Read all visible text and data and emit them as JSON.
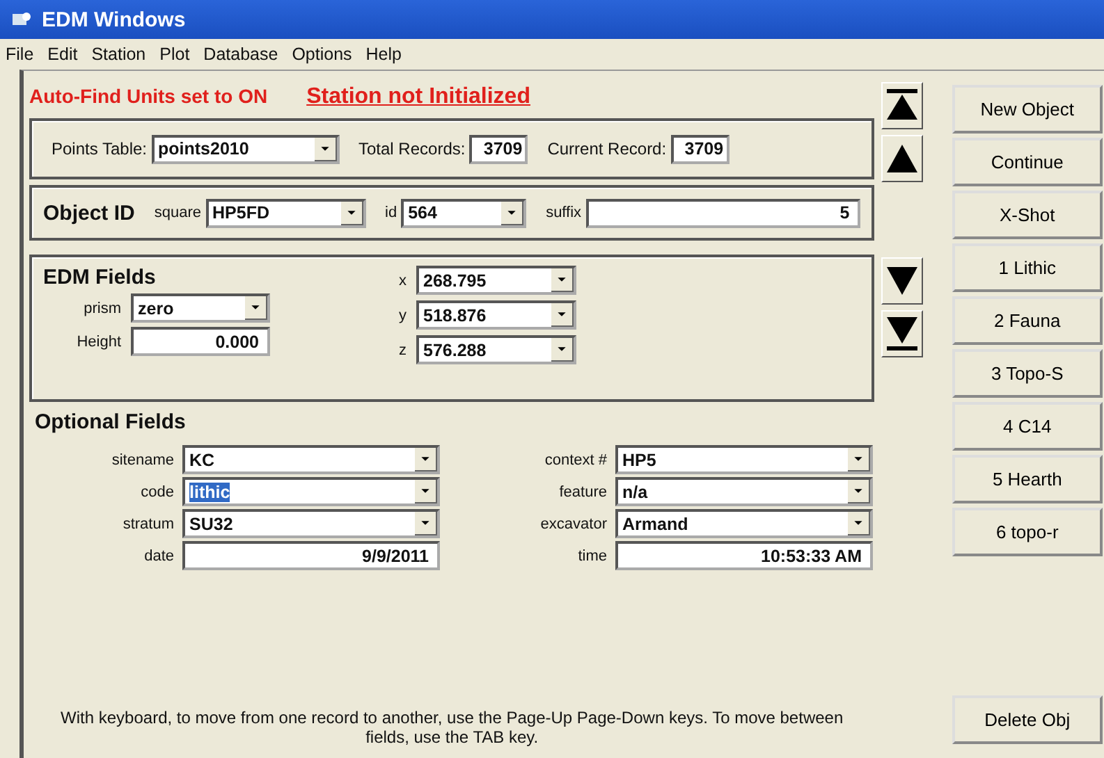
{
  "window": {
    "title": "EDM Windows"
  },
  "menu": [
    "File",
    "Edit",
    "Station",
    "Plot",
    "Database",
    "Options",
    "Help"
  ],
  "status": {
    "autofind": "Auto-Find Units set to ON",
    "station": "Station not Initialized"
  },
  "points": {
    "table_label": "Points Table:",
    "table_value": "points2010",
    "total_label": "Total Records:",
    "total_value": "3709",
    "current_label": "Current Record:",
    "current_value": "3709"
  },
  "object_id": {
    "title": "Object ID",
    "fields": [
      {
        "label": "square",
        "value": "HP5FD",
        "kind": "combo"
      },
      {
        "label": "id",
        "value": "564",
        "kind": "combo"
      },
      {
        "label": "suffix",
        "value": "5",
        "kind": "text"
      }
    ]
  },
  "edm_fields": {
    "title": "EDM Fields",
    "left": [
      {
        "label": "prism",
        "value": "zero",
        "kind": "combo"
      },
      {
        "label": "Height",
        "value": "0.000",
        "kind": "text"
      }
    ],
    "right": [
      {
        "label": "x",
        "value": "268.795",
        "kind": "combo"
      },
      {
        "label": "y",
        "value": "518.876",
        "kind": "combo"
      },
      {
        "label": "z",
        "value": "576.288",
        "kind": "combo"
      }
    ]
  },
  "optional_fields": {
    "title": "Optional Fields",
    "left": [
      {
        "label": "sitename",
        "value": "KC",
        "kind": "combo",
        "highlighted": false
      },
      {
        "label": "code",
        "value": "lithic",
        "kind": "combo",
        "highlighted": true
      },
      {
        "label": "stratum",
        "value": "SU32",
        "kind": "combo",
        "highlighted": false
      },
      {
        "label": "date",
        "value": "9/9/2011",
        "kind": "text",
        "highlighted": false
      }
    ],
    "right": [
      {
        "label": "context #",
        "value": "HP5",
        "kind": "combo",
        "highlighted": false
      },
      {
        "label": "feature",
        "value": "n/a",
        "kind": "combo",
        "highlighted": false
      },
      {
        "label": "excavator",
        "value": "Armand",
        "kind": "combo",
        "highlighted": false
      },
      {
        "label": "time",
        "value": "10:53:33 AM",
        "kind": "text",
        "highlighted": false
      }
    ]
  },
  "nav_buttons": [
    {
      "kind": "first"
    },
    {
      "kind": "prev"
    },
    {
      "kind": "next"
    },
    {
      "kind": "last"
    }
  ],
  "buttons": [
    "New Object",
    "Continue",
    "X-Shot",
    "1 Lithic",
    "2 Fauna",
    "3 Topo-S",
    "4 C14",
    "5 Hearth",
    "6 topo-r"
  ],
  "help_text": "With keyboard, to move from one record to another, use the Page-Up Page-Down keys.  To move between fields, use the TAB key.",
  "delete_button": "Delete Obj"
}
